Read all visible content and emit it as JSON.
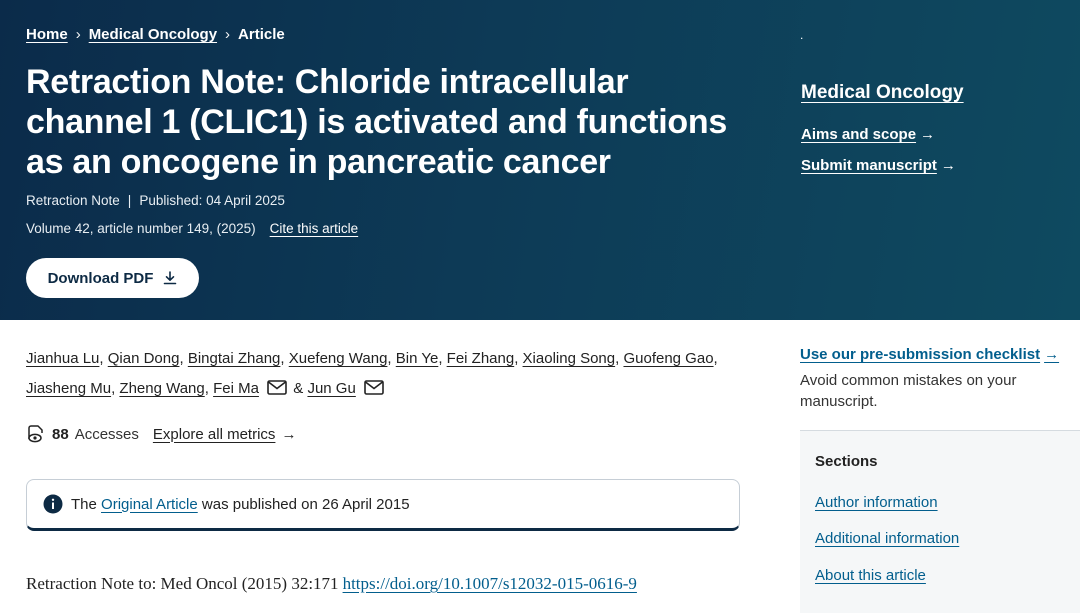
{
  "breadcrumb": {
    "home": "Home",
    "journal": "Medical Oncology",
    "current": "Article",
    "separator": "›"
  },
  "header_dot": ".",
  "article": {
    "title": "Retraction Note: Chloride intracellular channel 1 (CLIC1) is activated and functions as an oncogene in pancreatic cancer",
    "type": "Retraction Note",
    "published": "Published: 04 April 2025",
    "volume": "Volume 42, article number 149, (2025)",
    "cite_label": "Cite this article",
    "download_label": "Download PDF"
  },
  "sidebar_top": {
    "journal_name": "Medical Oncology",
    "aims_scope": "Aims and scope",
    "submit": "Submit manuscript",
    "arrow": "→"
  },
  "authors": [
    "Jianhua Lu",
    "Qian Dong",
    "Bingtai Zhang",
    "Xuefeng Wang",
    "Bin Ye",
    "Fei Zhang",
    "Xiaoling Song",
    "Guofeng Gao",
    "Jiasheng Mu",
    "Zheng Wang",
    "Fei Ma",
    "Jun Gu"
  ],
  "author_separators": {
    "comma": ",",
    "ampersand": "&"
  },
  "metrics": {
    "count": "88",
    "label": "Accesses",
    "explore": "Explore all metrics",
    "arrow": "→"
  },
  "notice": {
    "prefix": "The",
    "link": "Original Article",
    "suffix": "was published on 26 April 2015"
  },
  "retraction": {
    "text": "Retraction Note to: Med Oncol (2015) 32:171",
    "doi": "https://doi.org/10.1007/s12032-015-0616-9"
  },
  "checklist": {
    "link": "Use our pre-submission checklist",
    "arrow": "→",
    "description": "Avoid common mistakes on your manuscript."
  },
  "sections": {
    "title": "Sections",
    "items": [
      "Author information",
      "Additional information",
      "About this article"
    ]
  },
  "colors": {
    "hero": "#0d3a56",
    "link": "#025e8d",
    "text": "#222222"
  }
}
